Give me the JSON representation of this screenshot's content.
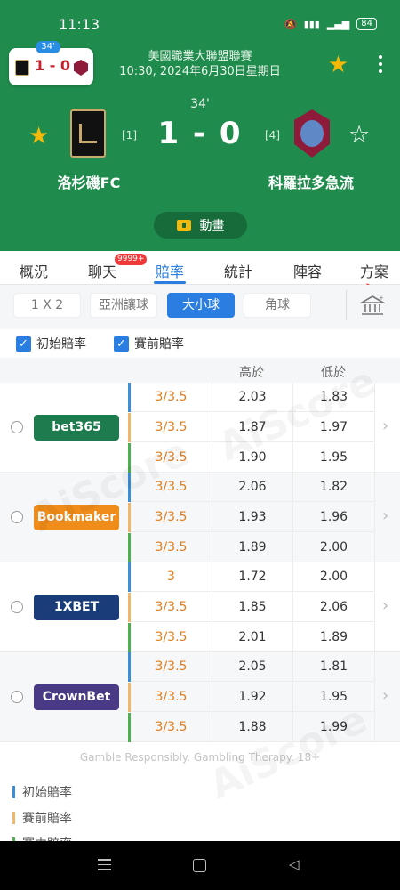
{
  "status": {
    "time": "11:13",
    "battery": "84",
    "icons": [
      "mute-icon",
      "signal-icon",
      "wifi-icon",
      "battery-icon"
    ]
  },
  "mini": {
    "minute": "34'",
    "score": "1 - 0"
  },
  "match": {
    "league": "美國職業大聯盟聯賽",
    "datetime": "10:30, 2024年6月30日星期日",
    "minute": "34'",
    "score": "1 - 0",
    "home": {
      "name": "洛杉磯FC",
      "rank": "[1]"
    },
    "away": {
      "name": "科羅拉多急流",
      "rank": "[4]"
    },
    "animation_label": "動畫"
  },
  "tabs": [
    {
      "label": "概況"
    },
    {
      "label": "聊天",
      "badge": "9999+"
    },
    {
      "label": "賠率"
    },
    {
      "label": "統計"
    },
    {
      "label": "陣容"
    },
    {
      "label": "方案"
    }
  ],
  "filters": [
    "1 X 2",
    "亞洲讓球",
    "大小球",
    "角球"
  ],
  "checks": {
    "initial": "初始賠率",
    "prematch": "賽前賠率"
  },
  "table_headers": {
    "over": "高於",
    "under": "低於"
  },
  "bookmakers": [
    {
      "name": "bet365",
      "bg": "#1d7b4d",
      "fg": "#ffffff",
      "rows": [
        [
          "3/3.5",
          "2.03",
          "1.83"
        ],
        [
          "3/3.5",
          "1.87",
          "1.97"
        ],
        [
          "3/3.5",
          "1.90",
          "1.95"
        ]
      ]
    },
    {
      "name": "Bookmaker",
      "bg": "#f08c1a",
      "fg": "#ffffff",
      "rows": [
        [
          "3/3.5",
          "2.06",
          "1.82"
        ],
        [
          "3/3.5",
          "1.93",
          "1.96"
        ],
        [
          "3/3.5",
          "1.89",
          "2.00"
        ]
      ]
    },
    {
      "name": "1XBET",
      "bg": "#1a3d7a",
      "fg": "#ffffff",
      "rows": [
        [
          "3",
          "1.72",
          "2.00"
        ],
        [
          "3/3.5",
          "1.85",
          "2.06"
        ],
        [
          "3/3.5",
          "2.01",
          "1.89"
        ]
      ]
    },
    {
      "name": "CrownBet",
      "bg": "#4a3a86",
      "fg": "#ffffff",
      "rows": [
        [
          "3/3.5",
          "2.05",
          "1.81"
        ],
        [
          "3/3.5",
          "1.92",
          "1.95"
        ],
        [
          "3/3.5",
          "1.88",
          "1.99"
        ]
      ]
    }
  ],
  "disclaimer": "Gamble Responsibly. Gambling Therapy. 18+",
  "legend": [
    {
      "label": "初始賠率",
      "color": "#3b8fd9"
    },
    {
      "label": "賽前賠率",
      "color": "#f0b66b"
    },
    {
      "label": "賽中賠率",
      "color": "#4caf50"
    }
  ],
  "watermark": "AiScore",
  "colors": {
    "header_green": "#1f8b4c",
    "accent_blue": "#2a7de1",
    "star": "#f5b90a",
    "handicap_orange": "#e07e1c"
  }
}
